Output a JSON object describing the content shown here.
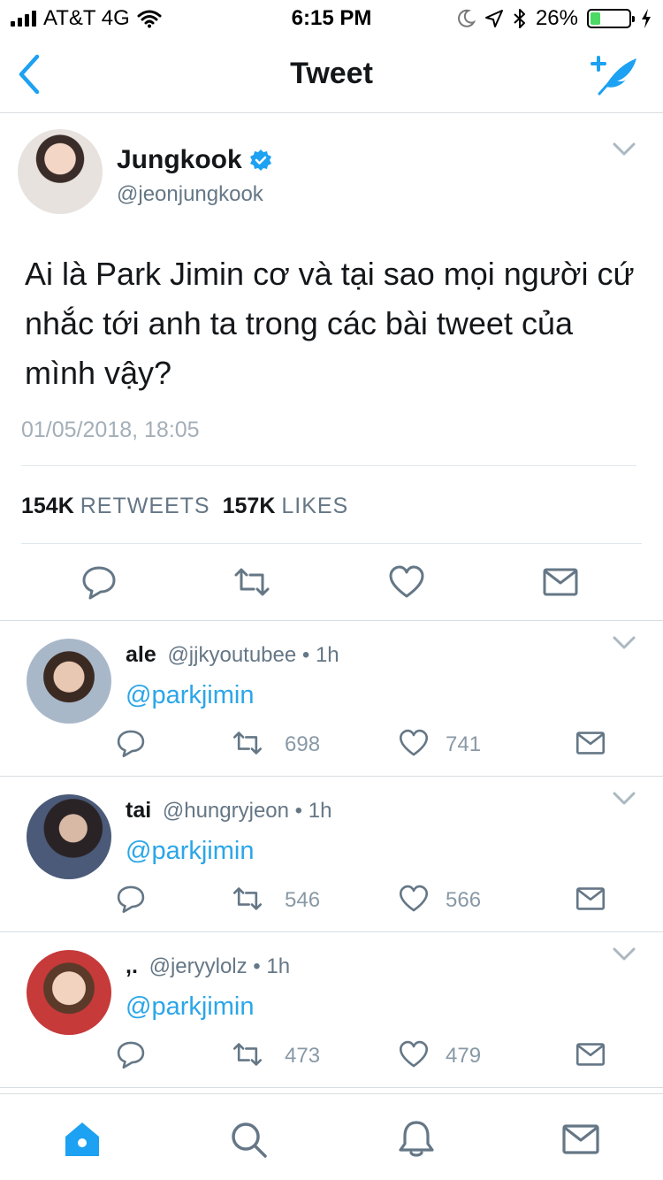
{
  "status_bar": {
    "carrier": "AT&T 4G",
    "time": "6:15 PM",
    "battery": "26%",
    "battery_level": 0.26
  },
  "nav": {
    "title": "Tweet"
  },
  "tweet": {
    "author_name": "Jungkook",
    "author_handle": "@jeonjungkook",
    "text": "Ai là Park Jimin cơ và tại sao mọi người cứ nhắc tới anh ta trong các bài tweet của mình vậy?",
    "timestamp": "01/05/2018, 18:05",
    "retweets_count": "154K",
    "retweets_label": "RETWEETS",
    "likes_count": "157K",
    "likes_label": "LIKES"
  },
  "replies": [
    {
      "name": "ale",
      "handle": "@jjkyoutubee",
      "time": "• 1h",
      "text": "@parkjimin",
      "retweets": "698",
      "likes": "741"
    },
    {
      "name": "tai",
      "handle": "@hungryjeon",
      "time": "• 1h",
      "text": "@parkjimin",
      "retweets": "546",
      "likes": "566"
    },
    {
      "name": ",.",
      "handle": "@jeryylolz",
      "time": "• 1h",
      "text": "@parkjimin",
      "retweets": "473",
      "likes": "479"
    }
  ],
  "colors": {
    "accent": "#1da1f2",
    "mention": "#2ba6e8",
    "muted": "#657786",
    "battery_fill": "#4cd964"
  },
  "icons": {
    "tab_bar": [
      "home-icon",
      "search-icon",
      "notifications-bell-icon",
      "messages-envelope-icon"
    ],
    "actions": [
      "reply-icon",
      "retweet-icon",
      "like-heart-icon",
      "direct-message-icon"
    ]
  }
}
